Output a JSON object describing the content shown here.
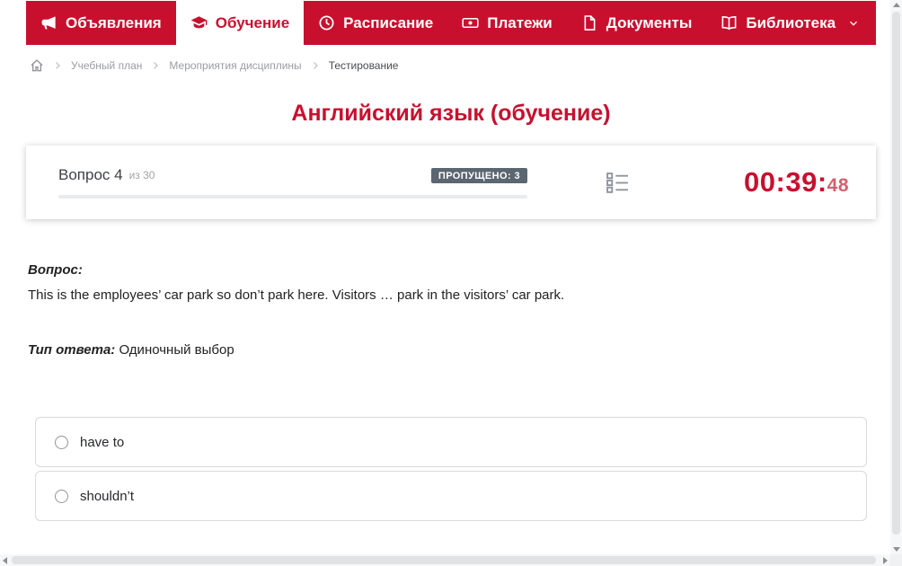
{
  "colors": {
    "accent": "#c8102e",
    "badge_bg": "#5b6670"
  },
  "nav": {
    "items": [
      {
        "label": "Объявления",
        "icon": "megaphone-icon",
        "active": false
      },
      {
        "label": "Обучение",
        "icon": "graduation-cap-icon",
        "active": true
      },
      {
        "label": "Расписание",
        "icon": "clock-icon",
        "active": false
      },
      {
        "label": "Платежи",
        "icon": "banknote-icon",
        "active": false
      },
      {
        "label": "Документы",
        "icon": "document-icon",
        "active": false
      },
      {
        "label": "Библиотека",
        "icon": "book-icon",
        "active": false,
        "has_dropdown": true
      }
    ]
  },
  "breadcrumb": {
    "home_icon": "home-icon",
    "items": [
      "Учебный план",
      "Мероприятия дисциплины",
      "Тестирование"
    ]
  },
  "page": {
    "title": "Английский язык (обучение)"
  },
  "question_panel": {
    "question_label": "Вопрос 4",
    "question_total": "из 30",
    "skipped_badge": "ПРОПУЩЕНО: 3",
    "timer_main": "00:39:",
    "timer_seconds": "48",
    "list_icon": "question-list-icon"
  },
  "question": {
    "label": "Вопрос:",
    "text": "This is the employees’ car park so don’t park here. Visitors … park in the visitors’ car park.",
    "type_label": "Тип ответа:",
    "type_value": "Одиночный выбор"
  },
  "answers": [
    {
      "label": "have to"
    },
    {
      "label": "shouldn’t"
    }
  ]
}
